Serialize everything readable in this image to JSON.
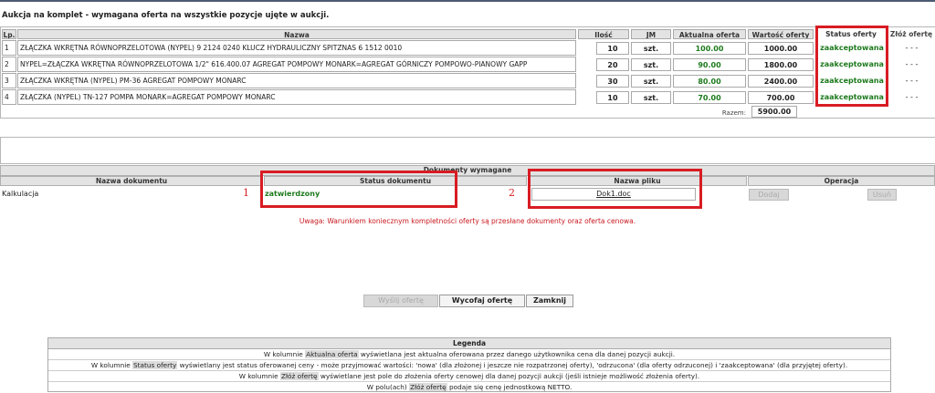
{
  "auction_title": "Aukcja na komplet - wymagana oferta na wszystkie pozycje ujęte w aukcji.",
  "items_table": {
    "headers": {
      "lp": "Lp.",
      "name": "Nazwa",
      "qty": "Ilość",
      "unit": "JM",
      "current_offer": "Aktualna oferta",
      "offer_value": "Wartość oferty",
      "status": "Status oferty",
      "submit": "Złóż ofertę"
    },
    "rows": [
      {
        "lp": "1",
        "name": "ZŁĄCZKA WKRĘTNA RÓWNOPRZELOTOWA (NYPEL) 9 2124 0240 KLUCZ HYDRAULICZNY SPITZNAS 6 1512 0010",
        "qty": "10",
        "unit": "szt.",
        "price": "100.00",
        "value": "1000.00",
        "status": "zaakceptowana",
        "submit": "- - -"
      },
      {
        "lp": "2",
        "name": "NYPEL=ZŁĄCZKA WKRĘTNA RÓWNOPRZELOTOWA 1/2\" 616.400.07 AGREGAT POMPOWY MONARK=AGREGAT GÓRNICZY POMPOWO-PIANOWY GAPP",
        "qty": "20",
        "unit": "szt.",
        "price": "90.00",
        "value": "1800.00",
        "status": "zaakceptowana",
        "submit": "- - -"
      },
      {
        "lp": "3",
        "name": "ZŁĄCZKA WKRĘTNA (NYPEL) PM-36 AGREGAT POMPOWY MONARC",
        "qty": "30",
        "unit": "szt.",
        "price": "80.00",
        "value": "2400.00",
        "status": "zaakceptowana",
        "submit": "- - -"
      },
      {
        "lp": "4",
        "name": "ZŁĄCZKA (NYPEL) TN-127 POMPA MONARK=AGREGAT POMPOWY MONARC",
        "qty": "10",
        "unit": "szt.",
        "price": "70.00",
        "value": "700.00",
        "status": "zaakceptowana",
        "submit": "- - -"
      }
    ],
    "total_label": "Razem:",
    "total_value": "5900.00"
  },
  "documents": {
    "title": "Dokumenty wymagane",
    "headers": {
      "name": "Nazwa dokumentu",
      "status": "Status dokumentu",
      "file": "Nazwa pliku",
      "operation": "Operacja"
    },
    "row": {
      "name": "Kalkulacja",
      "status": "zatwierdzony",
      "file": "Dok1.doc",
      "add": "Dodaj",
      "delete": "Usuń"
    }
  },
  "annotations": {
    "one": "1",
    "two": "2"
  },
  "warning": "Uwaga: Warunkiem koniecznym kompletności oferty są przesłane dokumenty oraz oferta cenowa.",
  "actions": {
    "send": "Wyślij ofertę",
    "withdraw": "Wycofaj ofertę",
    "close": "Zamknij"
  },
  "legend": {
    "title": "Legenda",
    "l1": {
      "a": "W kolumnie ",
      "hl": "Aktualna oferta",
      "b": " wyświetlana jest aktualna oferowana przez danego użytkownika cena dla danej pozycji aukcji."
    },
    "l2": {
      "a": "W kolumnie ",
      "hl": "Status oferty",
      "b": " wyświetlany jest status oferowanej ceny - może przyjmować wartości: 'nowa' (dla złożonej i jeszcze nie rozpatrzonej oferty), 'odrzucona' (dla oferty odrzuconej) i 'zaakceptowana' (dla przyjętej oferty)."
    },
    "l3": {
      "a": "W kolumnie ",
      "hl": "Złóż ofertę",
      "b": " wyświetlane jest pole do złożenia oferty cenowej dla danej pozycji aukcji (jeśli istnieje możliwość złożenia oferty)."
    },
    "l4": {
      "a": "W polu(ach) ",
      "hl": "Złóż ofertę",
      "b": " podaje się cenę jednostkową NETTO."
    }
  },
  "colors": {
    "accent_red": "#d81c23",
    "status_green": "#1d7a1d",
    "warning_red": "#c8191f"
  }
}
